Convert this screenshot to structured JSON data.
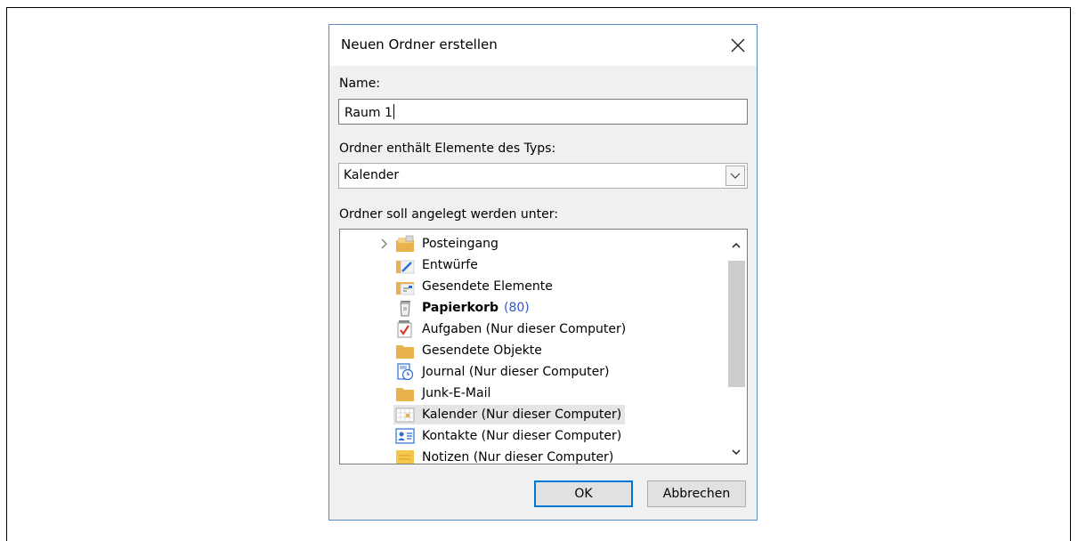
{
  "dialog": {
    "title": "Neuen Ordner erstellen",
    "close_icon": "close-icon"
  },
  "name_field": {
    "label": "Name:",
    "value": "Raum 1"
  },
  "type_field": {
    "label": "Ordner enthält Elemente des Typs:",
    "selected": "Kalender"
  },
  "location": {
    "label": "Ordner soll angelegt werden unter:",
    "items": [
      {
        "label": "Posteingang",
        "icon": "inbox-folder-icon",
        "expandable": true,
        "count": ""
      },
      {
        "label": "Entwürfe",
        "icon": "drafts-folder-icon",
        "expandable": false,
        "count": ""
      },
      {
        "label": "Gesendete Elemente",
        "icon": "sent-folder-icon",
        "expandable": false,
        "count": ""
      },
      {
        "label": "Papierkorb",
        "icon": "trash-icon",
        "expandable": false,
        "count": "(80)",
        "bold": true
      },
      {
        "label": "Aufgaben (Nur dieser Computer)",
        "icon": "tasks-icon",
        "expandable": false,
        "count": ""
      },
      {
        "label": "Gesendete Objekte",
        "icon": "folder-icon",
        "expandable": false,
        "count": ""
      },
      {
        "label": "Journal (Nur dieser Computer)",
        "icon": "journal-icon",
        "expandable": false,
        "count": ""
      },
      {
        "label": "Junk-E-Mail",
        "icon": "folder-icon",
        "expandable": false,
        "count": ""
      },
      {
        "label": "Kalender (Nur dieser Computer)",
        "icon": "calendar-icon",
        "expandable": false,
        "count": "",
        "selected": true
      },
      {
        "label": "Kontakte (Nur dieser Computer)",
        "icon": "contacts-icon",
        "expandable": false,
        "count": ""
      },
      {
        "label": "Notizen (Nur dieser Computer)",
        "icon": "notes-icon",
        "expandable": false,
        "count": ""
      }
    ]
  },
  "buttons": {
    "ok": "OK",
    "cancel": "Abbrechen"
  },
  "colors": {
    "accent": "#0078d7",
    "dialog_border": "#5a8bc9",
    "count": "#3355cc",
    "folder": "#e8b24d"
  }
}
